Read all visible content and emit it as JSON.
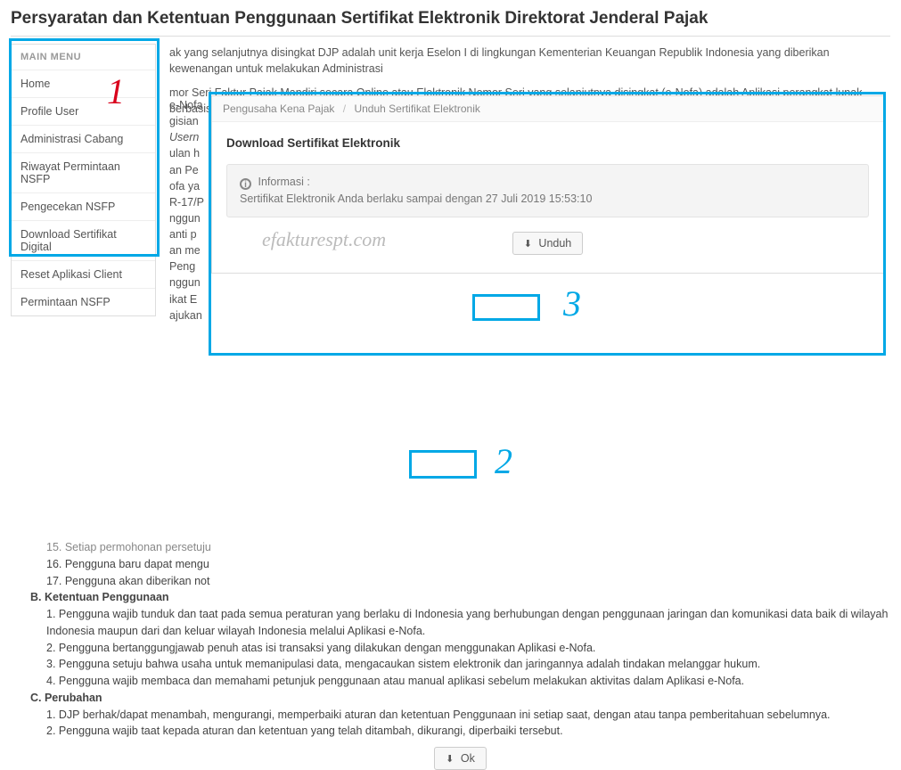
{
  "page_title": "Persyaratan dan Ketentuan Penggunaan Sertifikat Elektronik Direktorat Jenderal Pajak",
  "sidebar": {
    "header": "MAIN MENU",
    "items": [
      "Home",
      "Profile User",
      "Administrasi Cabang",
      "Riwayat Permintaan NSFP",
      "Pengecekan NSFP",
      "Download Sertifikat Digital",
      "Reset Aplikasi Client",
      "Permintaan NSFP"
    ]
  },
  "bg": {
    "p1": "ak yang selanjutnya disingkat DJP adalah unit kerja Eselon I di lingkungan Kementerian Keuangan Republik Indonesia yang diberikan kewenangan untuk melakukan Administrasi",
    "p2": "mor Seri Faktur Pajak Mandiri secara Online atau Elektronik Nomor Seri yang selanjutnya disingkat (e-Nofa) adalah Aplikasi perangkat lunak berbasis web yang terpasang di server"
  },
  "frag": [
    "e-Nofa",
    "gisian",
    "Usern",
    "ulan h",
    "an Pe",
    "ofa ya",
    "R-17/P",
    "nggun",
    "anti p",
    "an me",
    "Peng",
    "nggun",
    "ikat E",
    "ajukan"
  ],
  "modal": {
    "breadcrumb": {
      "a": "Pengusaha Kena Pajak",
      "b": "Unduh Sertifikat Elektronik"
    },
    "heading": "Download Sertifikat Elektronik",
    "info_title": "Informasi :",
    "info_body": "Sertifikat Elektronik Anda berlaku sampai dengan 27 Juli 2019 15:53:10",
    "unduh_label": "Unduh",
    "watermark": "efakturespt.com"
  },
  "terms": {
    "l_top_cut": "15. Setiap permohonan persetuju",
    "l16": "16. Pengguna baru dapat mengu",
    "l17": "17. Pengguna akan diberikan not",
    "secB": "B. Ketentuan Penggunaan",
    "b1": "1. Pengguna wajib tunduk dan taat pada semua peraturan yang berlaku di Indonesia yang berhubungan dengan penggunaan jaringan dan komunikasi data baik di wilayah Indonesia maupun dari dan keluar wilayah Indonesia melalui Aplikasi e-Nofa.",
    "b2": "2. Pengguna bertanggungjawab penuh atas isi transaksi yang dilakukan dengan menggunakan Aplikasi e-Nofa.",
    "b3": "3. Pengguna setuju bahwa usaha untuk memanipulasi data, mengacaukan sistem elektronik dan jaringannya adalah tindakan melanggar hukum.",
    "b4": "4. Pengguna wajib membaca dan memahami petunjuk penggunaan atau manual aplikasi sebelum melakukan aktivitas dalam Aplikasi e-Nofa.",
    "secC": "C. Perubahan",
    "c1": "1. DJP berhak/dapat menambah, mengurangi, memperbaiki aturan dan ketentuan Penggunaan ini setiap saat, dengan atau tanpa pemberitahuan sebelumnya.",
    "c2": "2. Pengguna wajib taat kepada aturan dan ketentuan yang telah ditambah, dikurangi, diperbaiki tersebut."
  },
  "ok_label": "Ok",
  "annotations": {
    "n1": "1",
    "n2": "2",
    "n3": "3"
  }
}
